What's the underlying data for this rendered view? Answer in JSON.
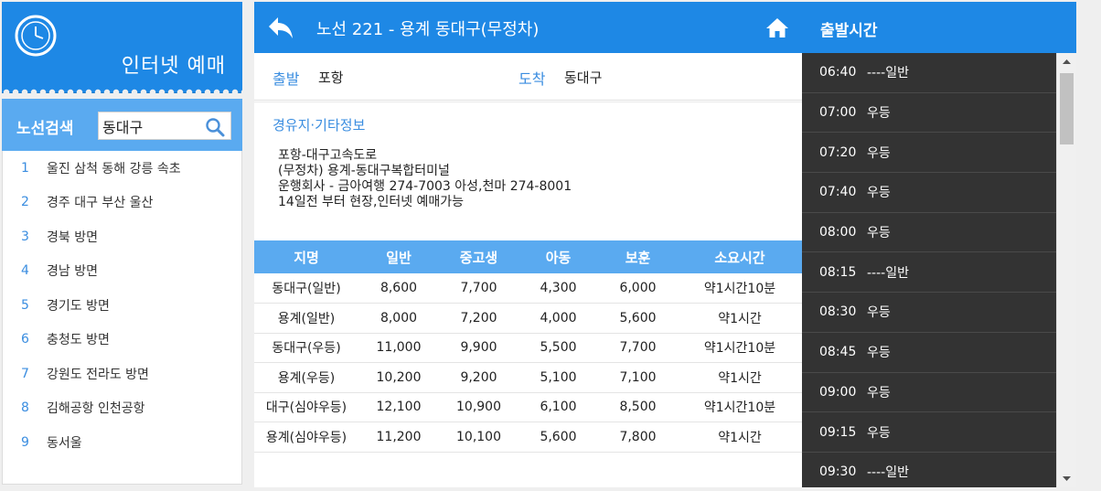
{
  "colors": {
    "primary": "#1e88e5",
    "secondary": "#5aaaf0",
    "accent_text": "#3a8de0",
    "time_panel_bg": "#333333"
  },
  "logo": {
    "text": "인터넷 예매",
    "icon": "clock-icon"
  },
  "search": {
    "label": "노선검색",
    "value": "동대구",
    "icon": "search-icon"
  },
  "routes": [
    {
      "num": "1",
      "name": "울진 삼척 동해 강릉 속초"
    },
    {
      "num": "2",
      "name": "경주 대구 부산 울산"
    },
    {
      "num": "3",
      "name": "경북 방면"
    },
    {
      "num": "4",
      "name": "경남 방면"
    },
    {
      "num": "5",
      "name": "경기도 방면"
    },
    {
      "num": "6",
      "name": "충청도 방면"
    },
    {
      "num": "7",
      "name": "강원도 전라도 방면"
    },
    {
      "num": "8",
      "name": "김해공항 인천공항"
    },
    {
      "num": "9",
      "name": "동서울"
    }
  ],
  "main": {
    "title": "노선 221 - 용계 동대구(무정차)",
    "back_icon": "back-arrow-icon",
    "home_icon": "home-icon",
    "departure_label": "출발",
    "departure": "포항",
    "arrival_label": "도착",
    "arrival": "동대구",
    "info_title": "경유지·기타정보",
    "info_lines": [
      "포항-대구고속도로",
      "(무정차) 용계-동대구복합터미널",
      "운행회사 - 금아여행 274-7003 아성,천마 274-8001",
      "14일전 부터 현장,인터넷 예매가능"
    ],
    "table": {
      "headers": [
        "지명",
        "일반",
        "중고생",
        "아동",
        "보훈",
        "소요시간"
      ],
      "rows": [
        [
          "동대구(일반)",
          "8,600",
          "7,700",
          "4,300",
          "6,000",
          "약1시간10분"
        ],
        [
          "용계(일반)",
          "8,000",
          "7,200",
          "4,000",
          "5,600",
          "약1시간"
        ],
        [
          "동대구(우등)",
          "11,000",
          "9,900",
          "5,500",
          "7,700",
          "약1시간10분"
        ],
        [
          "용계(우등)",
          "10,200",
          "9,200",
          "5,100",
          "7,100",
          "약1시간"
        ],
        [
          "대구(심야우등)",
          "12,100",
          "10,900",
          "6,100",
          "8,500",
          "약1시간10분"
        ],
        [
          "용계(심야우등)",
          "11,200",
          "10,100",
          "5,600",
          "7,800",
          "약1시간"
        ]
      ]
    }
  },
  "times": {
    "title": "출발시간",
    "items": [
      {
        "time": "06:40",
        "class": "----일반"
      },
      {
        "time": "07:00",
        "class": "우등"
      },
      {
        "time": "07:20",
        "class": "우등"
      },
      {
        "time": "07:40",
        "class": "우등"
      },
      {
        "time": "08:00",
        "class": "우등"
      },
      {
        "time": "08:15",
        "class": "----일반"
      },
      {
        "time": "08:30",
        "class": "우등"
      },
      {
        "time": "08:45",
        "class": "우등"
      },
      {
        "time": "09:00",
        "class": "우등"
      },
      {
        "time": "09:15",
        "class": "우등"
      },
      {
        "time": "09:30",
        "class": "----일반"
      }
    ]
  }
}
